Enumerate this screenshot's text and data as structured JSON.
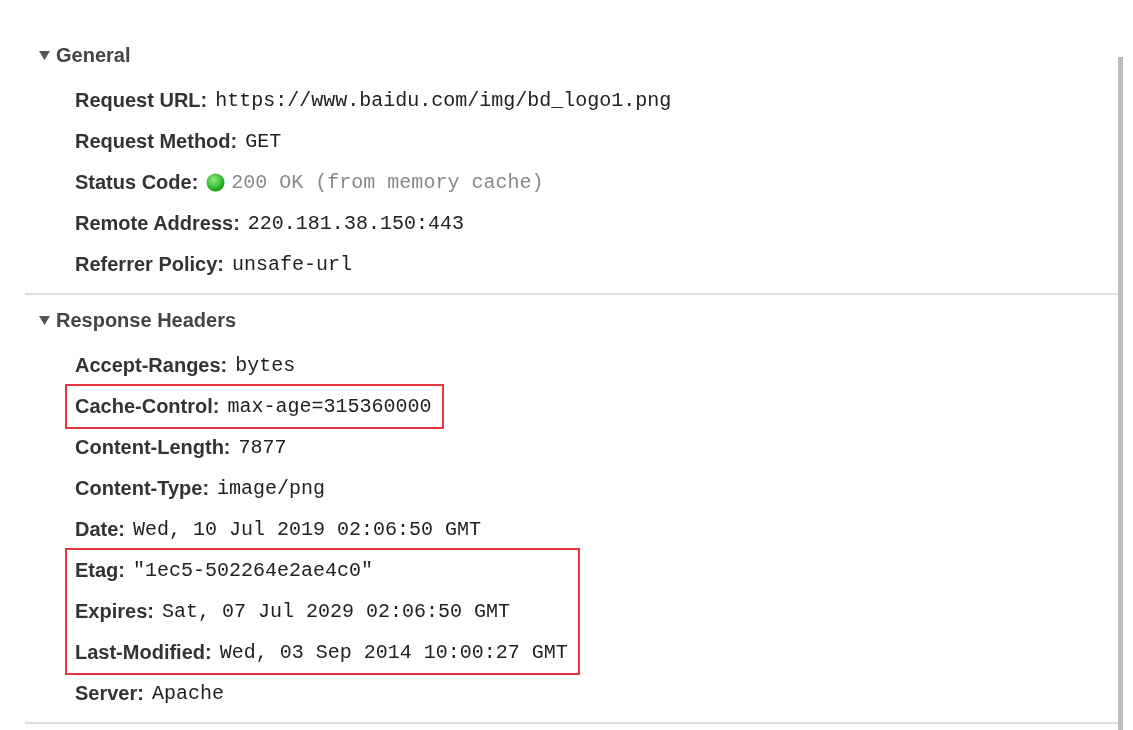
{
  "sections": [
    {
      "title": "General",
      "expanded": true,
      "rows": [
        {
          "label": "Request URL:",
          "value": "https://www.baidu.com/img/bd_logo1.png",
          "kind": "text",
          "highlighted": false
        },
        {
          "label": "Request Method:",
          "value": "GET",
          "kind": "text",
          "highlighted": false
        },
        {
          "label": "Status Code:",
          "value": "200 OK (from memory cache)",
          "kind": "status",
          "highlighted": false
        },
        {
          "label": "Remote Address:",
          "value": "220.181.38.150:443",
          "kind": "text",
          "highlighted": false
        },
        {
          "label": "Referrer Policy:",
          "value": "unsafe-url",
          "kind": "text",
          "highlighted": false
        }
      ]
    },
    {
      "title": "Response Headers",
      "expanded": true,
      "rows": [
        {
          "label": "Accept-Ranges:",
          "value": "bytes",
          "kind": "text",
          "highlighted": false
        },
        {
          "label": "Cache-Control:",
          "value": "max-age=315360000",
          "kind": "text",
          "highlighted": true
        },
        {
          "label": "Content-Length:",
          "value": "7877",
          "kind": "text",
          "highlighted": false
        },
        {
          "label": "Content-Type:",
          "value": "image/png",
          "kind": "text",
          "highlighted": false
        },
        {
          "label": "Date:",
          "value": "Wed, 10 Jul 2019 02:06:50 GMT",
          "kind": "text",
          "highlighted": false
        },
        {
          "label": "Etag:",
          "value": "\"1ec5-502264e2ae4c0\"",
          "kind": "text",
          "highlighted": true
        },
        {
          "label": "Expires:",
          "value": "Sat, 07 Jul 2029 02:06:50 GMT",
          "kind": "text",
          "highlighted": true
        },
        {
          "label": "Last-Modified:",
          "value": "Wed, 03 Sep 2014 10:00:27 GMT",
          "kind": "text",
          "highlighted": true
        },
        {
          "label": "Server:",
          "value": "Apache",
          "kind": "text",
          "highlighted": false
        }
      ]
    }
  ]
}
